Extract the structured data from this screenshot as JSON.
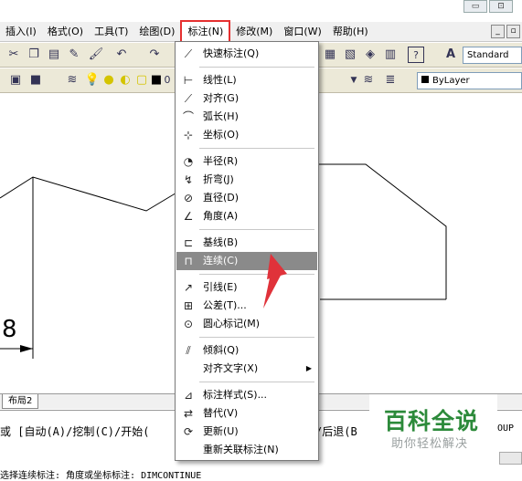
{
  "window": {
    "minimize": "▭",
    "restore": "⊡"
  },
  "menubar": {
    "items": [
      {
        "label": "插入(I)"
      },
      {
        "label": "格式(O)"
      },
      {
        "label": "工具(T)"
      },
      {
        "label": "绘图(D)"
      },
      {
        "label": "标注(N)",
        "active": true
      },
      {
        "label": "修改(M)"
      },
      {
        "label": "窗口(W)"
      },
      {
        "label": "帮助(H)"
      }
    ],
    "mdi_buttons": [
      "_",
      "▫"
    ]
  },
  "toolbar": {
    "text_style": "Standard",
    "layer_value": "0",
    "linetype": "ByLayer"
  },
  "layout_tab": {
    "label": "布局2"
  },
  "canvas": {
    "dimension_text": "8"
  },
  "dimension_menu": {
    "items": [
      {
        "label": "快速标注(Q)",
        "icon": "quick-dimension-icon",
        "glyph": "⟋"
      },
      {
        "label": "线性(L)",
        "icon": "linear-icon",
        "glyph": "⊢"
      },
      {
        "label": "对齐(G)",
        "icon": "aligned-icon",
        "glyph": "⟋"
      },
      {
        "label": "弧长(H)",
        "icon": "arc-length-icon",
        "glyph": "⌒"
      },
      {
        "label": "坐标(O)",
        "icon": "ordinate-icon",
        "glyph": "⊹"
      },
      {
        "label": "半径(R)",
        "icon": "radius-icon",
        "glyph": "◔"
      },
      {
        "label": "折弯(J)",
        "icon": "jogged-icon",
        "glyph": "↯"
      },
      {
        "label": "直径(D)",
        "icon": "diameter-icon",
        "glyph": "⊘"
      },
      {
        "label": "角度(A)",
        "icon": "angular-icon",
        "glyph": "∠"
      },
      {
        "label": "基线(B)",
        "icon": "baseline-icon",
        "glyph": "⊏"
      },
      {
        "label": "连续(C)",
        "icon": "continue-icon",
        "glyph": "⊓",
        "highlighted": true
      },
      {
        "label": "引线(E)",
        "icon": "leader-icon",
        "glyph": "↗"
      },
      {
        "label": "公差(T)...",
        "icon": "tolerance-icon",
        "glyph": "⊞"
      },
      {
        "label": "圆心标记(M)",
        "icon": "center-mark-icon",
        "glyph": "⊙"
      },
      {
        "label": "倾斜(Q)",
        "icon": "oblique-icon",
        "glyph": "⫽"
      },
      {
        "label": "对齐文字(X)",
        "icon": "",
        "glyph": "",
        "submenu": true
      },
      {
        "label": "标注样式(S)...",
        "icon": "dimension-style-icon",
        "glyph": "⊿"
      },
      {
        "label": "替代(V)",
        "icon": "override-icon",
        "glyph": "⇄"
      },
      {
        "label": "更新(U)",
        "icon": "update-icon",
        "glyph": "⟳"
      },
      {
        "label": "重新关联标注(N)",
        "icon": "",
        "glyph": ""
      }
    ]
  },
  "command": {
    "line1_a": "或 [自动(A)/挖制(C)/开始(",
    "line1_b": "/后退(B",
    "line1_c": "OUP",
    "line2": "选择连续标注: 角度或坐标标注: DIMCONTINUE"
  },
  "watermark": {
    "title": "百科全说",
    "subtitle": "助你轻松解决"
  },
  "annotation": {
    "arrow_color": "#e0323a"
  }
}
